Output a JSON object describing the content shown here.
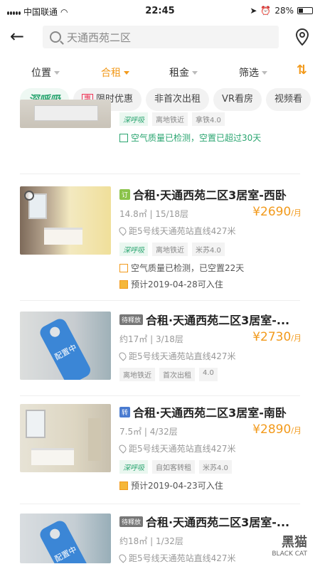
{
  "status": {
    "carrier": "中国联通",
    "time": "22:45",
    "battery": "28%"
  },
  "search": {
    "placeholder": "天通西苑二区"
  },
  "filters": [
    {
      "label": "位置",
      "active": false
    },
    {
      "label": "合租",
      "active": true
    },
    {
      "label": "租金",
      "active": false
    },
    {
      "label": "筛选",
      "active": false
    }
  ],
  "tags": [
    "深呼吸",
    "限时优惠",
    "非首次出租",
    "VR看房",
    "视频看"
  ],
  "tag_hui": "惠",
  "listings": [
    {
      "title": "",
      "badge": "",
      "meta": "",
      "price": "",
      "unit": "",
      "subway": "",
      "chips": [
        "深呼吸",
        "离地铁近",
        "拿铁4.0"
      ],
      "notes": [
        {
          "text": "空气质量已检测，空置已超过30天",
          "style": "green"
        }
      ]
    },
    {
      "title": "合租·天通西苑二区3居室-西卧",
      "badge": "订",
      "badge_color": "#8bc34a",
      "meta": "14.8㎡ | 15/18层",
      "price": "¥2690",
      "unit": "/月",
      "subway": "距5号线天通苑站直线427米",
      "chips": [
        "深呼吸",
        "离地铁近",
        "米苏4.0"
      ],
      "notes": [
        {
          "text": "空气质量已检测，已空置22天",
          "style": "orange"
        },
        {
          "text": "预计2019-04-28可入住",
          "style": "orange-fill"
        }
      ]
    },
    {
      "title": "合租·天通西苑二区3居室-...",
      "badge": "待释放",
      "badge_color": "#777",
      "meta": "约17㎡ | 3/18层",
      "price": "¥2730",
      "unit": "/月",
      "subway": "距5号线天通苑站直线427米",
      "chips": [
        "离地铁近",
        "首次出租",
        "4.0"
      ],
      "notes": [],
      "hang_tag": "配置中"
    },
    {
      "title": "合租·天通西苑二区3居室-南卧",
      "badge": "转",
      "badge_color": "#4a7bd0",
      "meta": "7.5㎡ | 4/32层",
      "price": "¥2890",
      "unit": "/月",
      "subway": "距5号线天通苑站直线427米",
      "chips": [
        "深呼吸",
        "自如客转租",
        "米苏4.0"
      ],
      "notes": [
        {
          "text": "预计2019-04-23可入住",
          "style": "orange-fill"
        }
      ]
    },
    {
      "title": "合租·天通西苑二区3居室-...",
      "badge": "待释放",
      "badge_color": "#777",
      "meta": "约18㎡ | 1/32层",
      "price": "",
      "unit": "",
      "subway": "距5号线天通苑站直线427米",
      "chips": [],
      "notes": [],
      "hang_tag": "配置中"
    }
  ],
  "watermark": {
    "brand": "黑猫",
    "sub": "BLACK CAT"
  }
}
